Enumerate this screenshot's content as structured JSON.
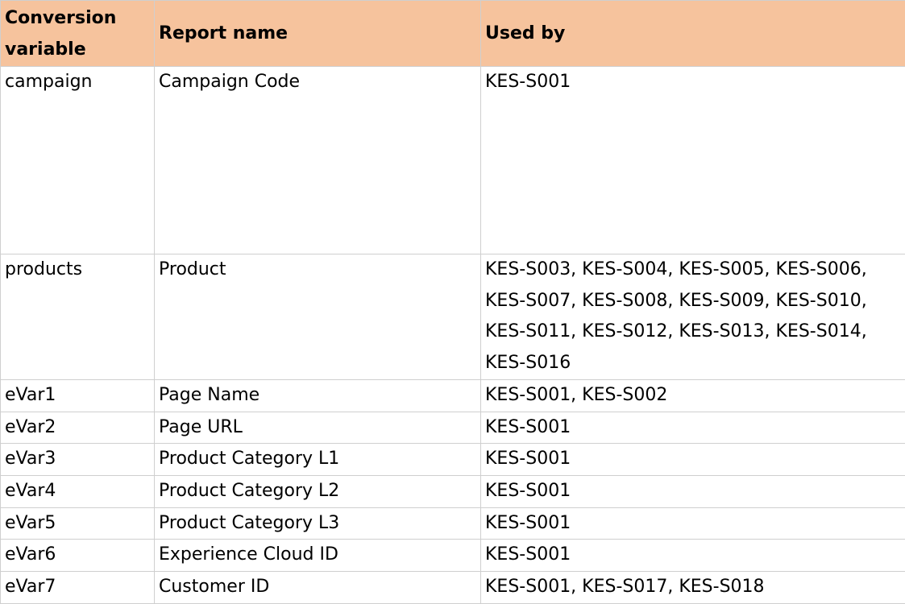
{
  "table": {
    "headers": [
      "Conversion variable",
      "Report name",
      "Used by"
    ],
    "rows": [
      {
        "variable": "campaign",
        "report_name": "Campaign Code",
        "used_by": "KES-S001"
      },
      {
        "variable": "products",
        "report_name": "Product",
        "used_by": "KES-S003, KES-S004, KES-S005, KES-S006, KES-S007, KES-S008, KES-S009, KES-S010, KES-S011, KES-S012, KES-S013, KES-S014, KES-S016"
      },
      {
        "variable": "eVar1",
        "report_name": "Page Name",
        "used_by": "KES-S001, KES-S002"
      },
      {
        "variable": "eVar2",
        "report_name": "Page URL",
        "used_by": "KES-S001"
      },
      {
        "variable": "eVar3",
        "report_name": "Product Category L1",
        "used_by": "KES-S001"
      },
      {
        "variable": "eVar4",
        "report_name": "Product Category L2",
        "used_by": "KES-S001"
      },
      {
        "variable": "eVar5",
        "report_name": "Product Category L3",
        "used_by": "KES-S001"
      },
      {
        "variable": "eVar6",
        "report_name": "Experience Cloud ID",
        "used_by": "KES-S001"
      },
      {
        "variable": "eVar7",
        "report_name": "Customer ID",
        "used_by": "KES-S001, KES-S017, KES-S018"
      }
    ]
  },
  "colors": {
    "header_background": "#f6c39d",
    "grid_line": "#cfcfcf"
  }
}
